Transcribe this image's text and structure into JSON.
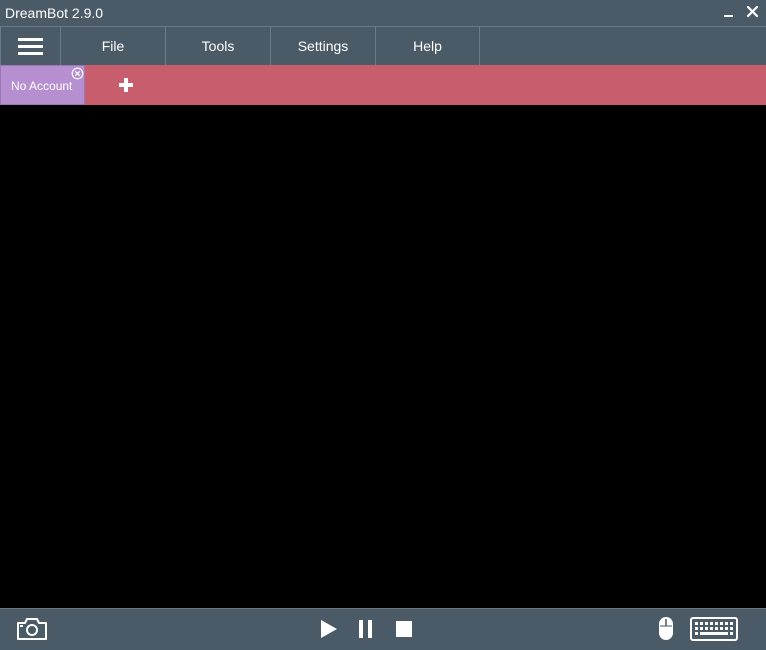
{
  "window": {
    "title": "DreamBot 2.9.0"
  },
  "menu": {
    "items": [
      {
        "label": "File"
      },
      {
        "label": "Tools"
      },
      {
        "label": "Settings"
      },
      {
        "label": "Help"
      }
    ]
  },
  "tabs": {
    "account_label": "No Account"
  },
  "icons": {
    "menu": "hamburger-icon",
    "minimize": "minimize-icon",
    "close": "close-icon",
    "tab_close": "circle-x-icon",
    "add_tab": "plus-icon",
    "screenshot": "camera-icon",
    "play": "play-icon",
    "pause": "pause-icon",
    "stop": "stop-icon",
    "mouse_input": "mouse-icon",
    "keyboard_input": "keyboard-icon"
  },
  "colors": {
    "chrome": "#4a5a67",
    "tab_bar": "#c85d6e",
    "account_tab": "#b58fcf",
    "canvas": "#000000"
  }
}
